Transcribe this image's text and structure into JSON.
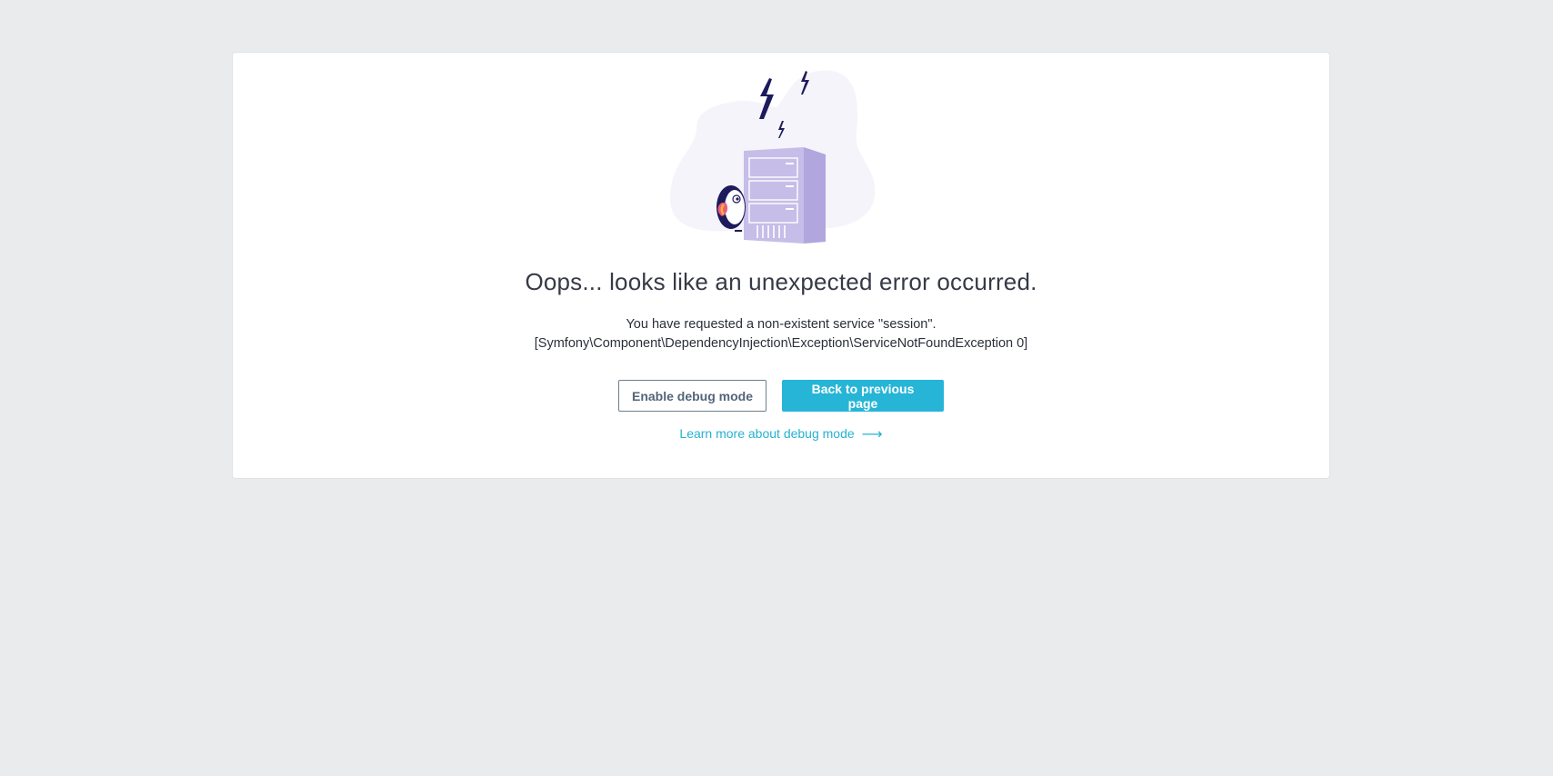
{
  "error": {
    "title": "Oops... looks like an unexpected error occurred.",
    "message_line1": "You have requested a non-existent service \"session\".",
    "message_line2": "[Symfony\\Component\\DependencyInjection\\Exception\\ServiceNotFoundException 0]"
  },
  "actions": {
    "debug_label": "Enable debug mode",
    "back_label": "Back to previous page",
    "learn_more_label": "Learn more about debug mode",
    "learn_more_icon": "arrow-right-icon"
  },
  "colors": {
    "page_background": "#eaebed",
    "card_background": "#ffffff",
    "accent": "#26b5d6",
    "title_text": "#363a46",
    "illustration_server": "#c6bde8",
    "illustration_blob": "#f5f4fb",
    "lightning": "#1d1b5c"
  },
  "illustration": {
    "name": "server-error-illustration"
  }
}
